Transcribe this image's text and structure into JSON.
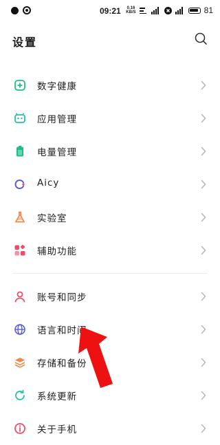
{
  "status_bar": {
    "time": "09:21",
    "speed_top": "0.16",
    "speed_bottom": "KB/S",
    "battery": "81"
  },
  "header": {
    "title": "设置"
  },
  "groups": [
    [
      {
        "label": "数字健康",
        "icon": "digital-wellbeing-icon",
        "color": "#1dbf86"
      },
      {
        "label": "应用管理",
        "icon": "android-icon",
        "color": "#23c2b0"
      },
      {
        "label": "电量管理",
        "icon": "battery-icon",
        "color": "#1dbf86"
      },
      {
        "label": "Aicy",
        "icon": "aicy-icon",
        "color": "#5b5bd6"
      },
      {
        "label": "实验室",
        "icon": "flask-icon",
        "color": "#f08a4b"
      },
      {
        "label": "辅助功能",
        "icon": "accessibility-icon",
        "color": "#ef4b6b"
      }
    ],
    [
      {
        "label": "账号和同步",
        "icon": "account-icon",
        "color": "#ef4b6b"
      },
      {
        "label": "语言和时间",
        "icon": "globe-icon",
        "color": "#5b5bd6"
      },
      {
        "label": "存储和备份",
        "icon": "storage-icon",
        "color": "#f08a4b"
      },
      {
        "label": "系统更新",
        "icon": "update-icon",
        "color": "#23c2b0"
      },
      {
        "label": "关于手机",
        "icon": "info-icon",
        "color": "#ef4b6b"
      }
    ]
  ]
}
